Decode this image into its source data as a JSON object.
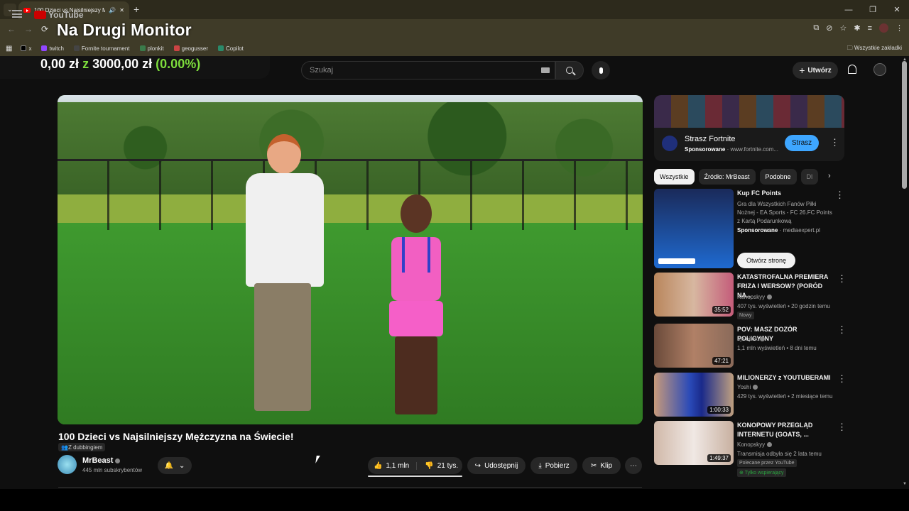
{
  "browser": {
    "tab_title": "100 Dzieci vs Najsilniejszy M",
    "overlay_title": "Na Drugi Monitor",
    "bookmarks": [
      "x",
      "twitch",
      "Fornite tournament",
      "plonkit",
      "geogusser",
      "Copilot"
    ],
    "all_bookmarks": "Wszystkie zakładki"
  },
  "overlay": {
    "money_left": "0,00 zł",
    "money_sep": "z",
    "money_goal": "3000,00 zł",
    "money_pct": "(0.00%)"
  },
  "header": {
    "logo": "YouTube",
    "search_placeholder": "Szukaj",
    "create_label": "Utwórz"
  },
  "video": {
    "title": "100 Dzieci vs Najsilniejszy Mężczyzna na Świecie!",
    "dubbing": "Z dubbingiem",
    "channel": "MrBeast",
    "subscribers": "445 mln subskrybentów",
    "likes": "1,1 mln",
    "dislikes": "21 tys.",
    "share": "Udostępnij",
    "download": "Pobierz",
    "clip": "Klip"
  },
  "sidebar": {
    "ad": {
      "title": "Strasz Fortnite",
      "sponsored": "Sponsorowane",
      "domain": "www.fortnite.com...",
      "button": "Strasz"
    },
    "chips": [
      "Wszystkie",
      "Źródło: MrBeast",
      "Podobne",
      "Dl"
    ],
    "items": [
      {
        "title": "Kup FC Points",
        "desc": "Gra dla Wszystkich Fanów Piłki Nożnej - EA Sports - FC 26.FC Points z Kartą Podarunkową",
        "channel": "Sponsorowane",
        "meta": "· mediaexpert.pl",
        "button": "Otwórz stronę"
      },
      {
        "title": "KATASTROFALNA PREMIERA FRIZA I WERSOW? (PORÓD NA...",
        "channel": "Konopskyy",
        "meta": "407 tys. wyświetleń • 20 godzin temu",
        "badge": "Nowy",
        "duration": "35:52"
      },
      {
        "title": "POV: MASZ DOZÓR POLICYJNY",
        "channel": "ojwojtek",
        "meta": "1,1 mln wyświetleń • 8 dni temu",
        "duration": "47:21"
      },
      {
        "title": "MILIONERZY z YOUTUBERAMI",
        "channel": "Yoshi",
        "meta": "429 tys. wyświetleń • 2 miesiące temu",
        "duration": "1:00:33"
      },
      {
        "title": "KONOPOWY PRZEGLĄD INTERNETU (GOATS, ...",
        "channel": "Konopskyy",
        "meta": "Transmisja odbyła się 2 lata temu",
        "badge": "Polecane przez YouTube",
        "badge2": "Tylko wspierający",
        "duration": "1:49:37"
      }
    ]
  }
}
